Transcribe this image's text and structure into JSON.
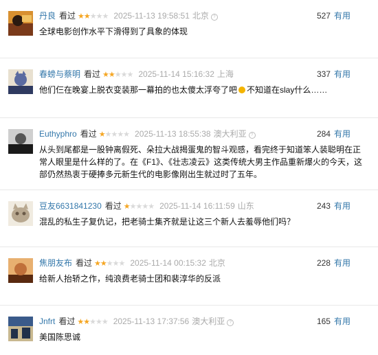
{
  "reviews": [
    {
      "user": "丹良",
      "watched": "看过",
      "rating": 2,
      "time": "2025-11-13 19:58:51",
      "location": "北京",
      "votes": "527",
      "useful_label": "有用",
      "comment": "全球电影创作水平下滑得到了具象的体现",
      "avatar_colors": [
        "#7a3a1a",
        "#d89030",
        "#2a1a10"
      ]
    },
    {
      "user": "春螃与蔡明",
      "watched": "看过",
      "rating": 2,
      "time": "2025-11-14 15:16:32",
      "location": "上海",
      "votes": "337",
      "useful_label": "有用",
      "comment_pre": "他们仨在晚宴上脱衣变装那一幕拍的也太傻太浮夸了吧",
      "comment_post": "不知道在slay什么……",
      "avatar_colors": [
        "#5a6aa0",
        "#e8e0d0",
        "#2f3a60"
      ]
    },
    {
      "user": "Euthyphro",
      "watched": "看过",
      "rating": 1,
      "time": "2025-11-13 18:55:38",
      "location": "澳大利亚",
      "votes": "284",
      "useful_label": "有用",
      "comment": "从头到尾都是一股钟离假死、朵拉大战揭蛋鬼的智斗观感，看完终于知道笨人装聪明在正常人眼里是什么样的了。在《F1》、《壮志凌云》这类传统大男主作品重新爆火的今天，这部仍然热衷于硬捧多元新生代的电影像刚出生就过时了五年。",
      "avatar_colors": [
        "#cfcfcf",
        "#555555",
        "#1a1a1a"
      ]
    },
    {
      "user": "豆友6631841230",
      "watched": "看过",
      "rating": 1,
      "time": "2025-11-14 16:11:59",
      "location": "山东",
      "votes": "243",
      "useful_label": "有用",
      "comment": "混乱的私生子复仇记，把老骑士集齐就是让这三个新人去羞辱他们吗？",
      "avatar_colors": [
        "#b8a890",
        "#6a5a48",
        "#f0ebe0"
      ]
    },
    {
      "user": "焦朋友布",
      "watched": "看过",
      "rating": 2,
      "time": "2025-11-14 00:15:32",
      "location": "北京",
      "votes": "228",
      "useful_label": "有用",
      "comment": "给新人抬轿之作，纯浪费老骑士团和裴淳华的反派",
      "avatar_colors": [
        "#c0703a",
        "#e8b070",
        "#5a2a10"
      ]
    },
    {
      "user": "Jnfrt",
      "watched": "看过",
      "rating": 2,
      "time": "2025-11-13 17:37:56",
      "location": "澳大利亚",
      "votes": "165",
      "useful_label": "有用",
      "comment": "美国陈思诚",
      "avatar_colors": [
        "#3a5a8a",
        "#c8b890",
        "#20304a"
      ]
    }
  ]
}
